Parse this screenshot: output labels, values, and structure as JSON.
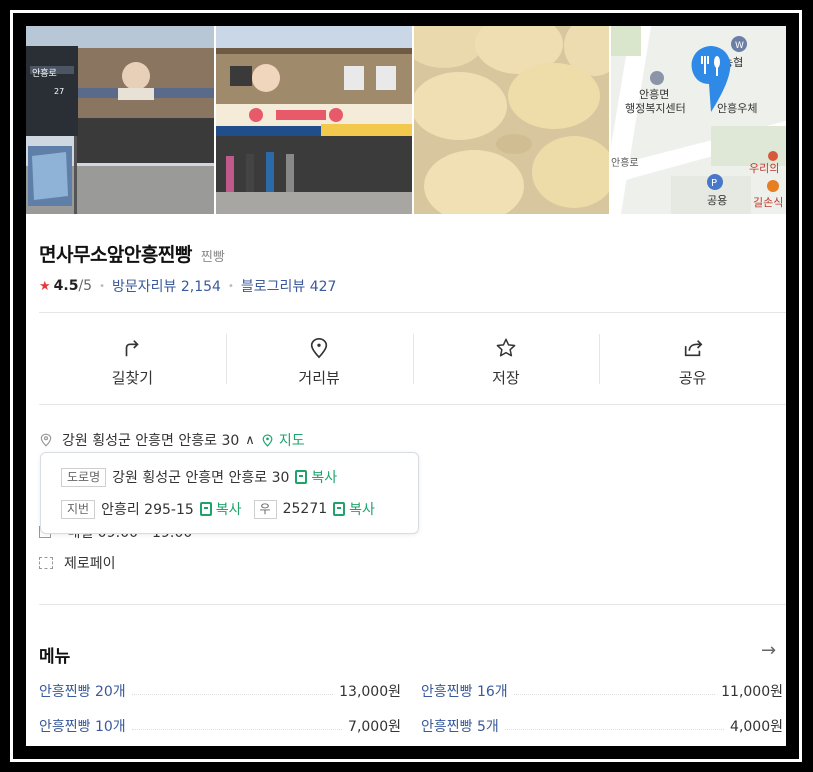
{
  "place": {
    "name": "면사무소앞안흥찐빵",
    "category": "찐빵",
    "rating": "4.5",
    "rating_max": "/5",
    "visitor_reviews_label": "방문자리뷰 2,154",
    "blog_reviews_label": "블로그리뷰 427"
  },
  "photos": {
    "sign_text_1": "안흥로",
    "sign_text_2": "27",
    "map_labels": {
      "bank": "농협",
      "office_1": "안흥면",
      "office_2": "행정복지센터",
      "post": "안흥우체",
      "road": "안흥로",
      "bank2": "우리의",
      "parking": "공용",
      "restaurant": "길손식"
    }
  },
  "actions": [
    {
      "label": "길찾기",
      "icon": "directions-icon"
    },
    {
      "label": "거리뷰",
      "icon": "street-view-icon"
    },
    {
      "label": "저장",
      "icon": "star-icon"
    },
    {
      "label": "공유",
      "icon": "share-icon"
    }
  ],
  "address": {
    "summary": "강원 횡성군 안흥면 안흥로 30",
    "map_link": "지도",
    "road_tag": "도로명",
    "road_address": "강원 횡성군 안흥면 안흥로 30",
    "lot_tag": "지번",
    "lot_address": "안흥리 295-15",
    "zip_tag": "우",
    "zip": "25271",
    "copy_label": "복사"
  },
  "hidden_row_text": "매일 09:00 - 19:00",
  "zeropay": "제로페이",
  "menu": {
    "title": "메뉴",
    "items": [
      {
        "name": "안흥찐빵 20개",
        "price": "13,000원"
      },
      {
        "name": "안흥찐빵 16개",
        "price": "11,000원"
      },
      {
        "name": "안흥찐빵 10개",
        "price": "7,000원"
      },
      {
        "name": "안흥찐빵 5개",
        "price": "4,000원"
      }
    ]
  },
  "colors": {
    "link_blue": "#3a5a9b",
    "accent_green": "#1ea36a",
    "star_red": "#e23b3b",
    "map_pin_blue": "#2e8ae6"
  }
}
